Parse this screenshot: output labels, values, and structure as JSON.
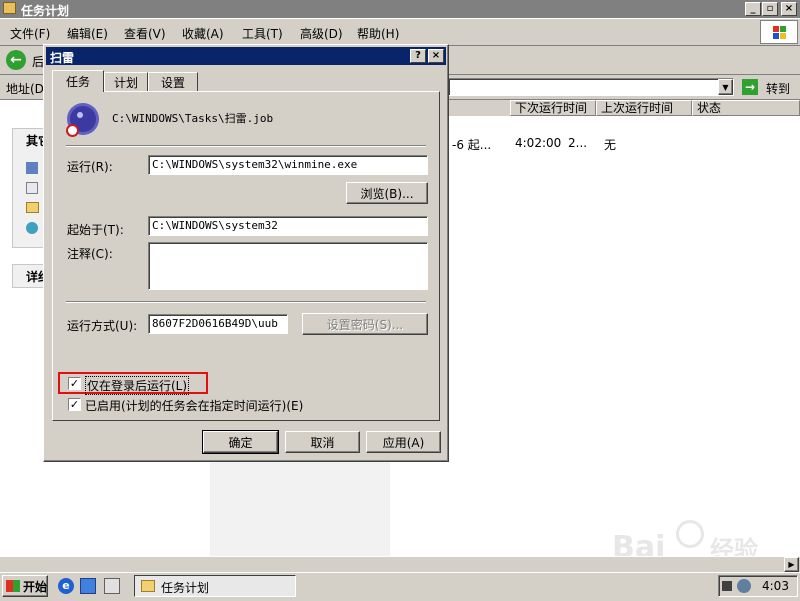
{
  "window": {
    "title": "任务计划"
  },
  "menu": [
    "文件(F)",
    "编辑(E)",
    "查看(V)",
    "收藏(A)",
    "工具(T)",
    "高级(D)",
    "帮助(H)"
  ],
  "toolbar": {
    "back_label": "后"
  },
  "address": {
    "label": "地址(D)",
    "go_label": "转到"
  },
  "columns": [
    "下次运行时间",
    "上次运行时间",
    "状态"
  ],
  "row": {
    "col0": "-6 起...",
    "next": "4:02:00",
    "last": "2...",
    "status": "无"
  },
  "left_panel": {
    "other_title": "其它",
    "detail_title": "详细"
  },
  "dialog": {
    "title": "扫雷",
    "help_btn": "?",
    "close_btn": "×",
    "tabs": [
      "任务",
      "计划",
      "设置"
    ],
    "job_path": "C:\\WINDOWS\\Tasks\\扫雷.job",
    "run_label": "运行(R):",
    "run_value": "C:\\WINDOWS\\system32\\winmine.exe",
    "browse_label": "浏览(B)...",
    "start_in_label": "起始于(T):",
    "start_in_value": "C:\\WINDOWS\\system32",
    "comment_label": "注释(C):",
    "comment_value": "",
    "run_as_label": "运行方式(U):",
    "run_as_value": "8607F2D0616B49D\\uub",
    "set_password_label": "设置密码(S)...",
    "only_logged_on_label": "仅在登录后运行(L)",
    "only_logged_on_checked": true,
    "enabled_label": "已启用(计划的任务会在指定时间运行)(E)",
    "enabled_checked": true,
    "ok_label": "确定",
    "cancel_label": "取消",
    "apply_label": "应用(A)"
  },
  "taskbar": {
    "start_label": "开始",
    "task_label": "任务计划",
    "clock": "4:03"
  },
  "colors": {
    "titlebar": "#0a246a",
    "highlight": "#e01010",
    "desktop_gray": "#d4d0c8"
  }
}
